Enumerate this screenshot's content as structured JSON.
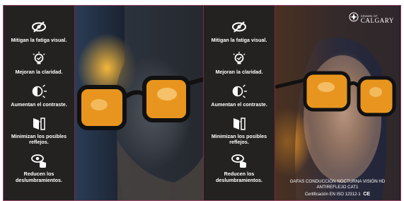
{
  "features_left": [
    {
      "icon": "eye-slash-icon",
      "label": "Mitigan la fatiga visual."
    },
    {
      "icon": "lightbulb-check-icon",
      "label": "Mejoran la claridad."
    },
    {
      "icon": "contrast-sun-icon",
      "label": "Aumentan el contraste."
    },
    {
      "icon": "reflection-icon",
      "label": "Minimizan los posibles reflejos."
    },
    {
      "icon": "eye-hand-icon",
      "label": "Reducen los deslumbramientos."
    }
  ],
  "features_right": [
    {
      "icon": "eye-slash-icon",
      "label": "Mitigan la fatiga visual."
    },
    {
      "icon": "lightbulb-check-icon",
      "label": "Mejoran la claridad."
    },
    {
      "icon": "contrast-sun-icon",
      "label": "Aumentan el contraste."
    },
    {
      "icon": "reflection-icon",
      "label": "Minimizan los posibles reflejos."
    },
    {
      "icon": "eye-hand-icon",
      "label": "Reducen los deslumbramientos."
    }
  ],
  "logo": {
    "small": "DRAWN OF",
    "big": "CALGARY"
  },
  "caption": {
    "line1": "GAFAS CONDUCCIÓN NOCTURNA VISIÓN HD",
    "line2": "ANTIREFLEJO CAT1",
    "line3": "Certificación EN ISO 12312-1",
    "ce": "CE"
  },
  "colors": {
    "panel": "#232220",
    "border": "#9e4b6b",
    "lens": "#e8951f"
  }
}
